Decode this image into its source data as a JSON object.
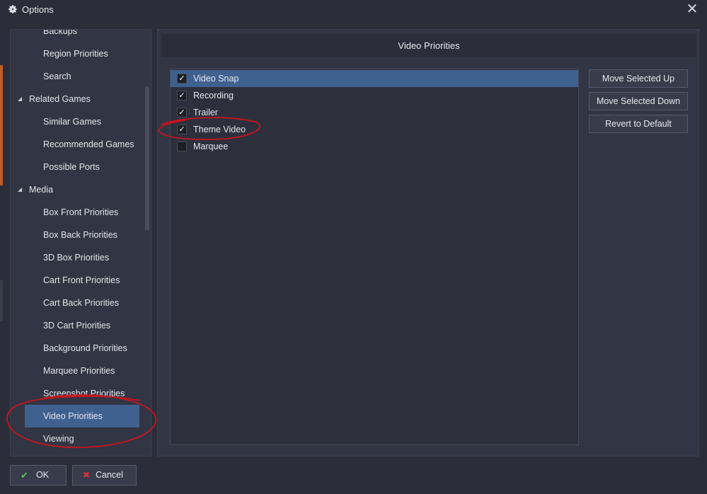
{
  "window": {
    "title": "Options",
    "close_glyph": "✕",
    "title_icon": "gear-icon"
  },
  "sidebar": {
    "items": [
      {
        "label": "Backups",
        "level": "child"
      },
      {
        "label": "Region Priorities",
        "level": "child"
      },
      {
        "label": "Search",
        "level": "child"
      },
      {
        "label": "Related Games",
        "level": "parent",
        "expanded": true
      },
      {
        "label": "Similar Games",
        "level": "child"
      },
      {
        "label": "Recommended Games",
        "level": "child"
      },
      {
        "label": "Possible Ports",
        "level": "child"
      },
      {
        "label": "Media",
        "level": "parent",
        "expanded": true
      },
      {
        "label": "Box Front Priorities",
        "level": "child"
      },
      {
        "label": "Box Back Priorities",
        "level": "child"
      },
      {
        "label": "3D Box Priorities",
        "level": "child"
      },
      {
        "label": "Cart Front Priorities",
        "level": "child"
      },
      {
        "label": "Cart Back Priorities",
        "level": "child"
      },
      {
        "label": "3D Cart Priorities",
        "level": "child"
      },
      {
        "label": "Background Priorities",
        "level": "child"
      },
      {
        "label": "Marquee Priorities",
        "level": "child"
      },
      {
        "label": "Screenshot Priorities",
        "level": "child"
      },
      {
        "label": "Video Priorities",
        "level": "child",
        "selected": true
      },
      {
        "label": "Viewing",
        "level": "child"
      }
    ]
  },
  "content": {
    "header": "Video Priorities",
    "list": [
      {
        "label": "Video Snap",
        "checked": true,
        "selected": true
      },
      {
        "label": "Recording",
        "checked": true
      },
      {
        "label": "Trailer",
        "checked": true
      },
      {
        "label": "Theme Video",
        "checked": true
      },
      {
        "label": "Marquee",
        "checked": false
      }
    ],
    "buttons": {
      "move_up": "Move Selected Up",
      "move_down": "Move Selected Down",
      "revert": "Revert to Default"
    }
  },
  "footer": {
    "ok_label": "OK",
    "cancel_label": "Cancel",
    "ok_icon": "checkmark-icon",
    "cancel_icon": "cancel-icon"
  },
  "colors": {
    "accent_selection": "#3f6190",
    "annotation_red": "#c8141e",
    "ok_green": "#4ecb5a",
    "cancel_red": "#d8343c"
  }
}
